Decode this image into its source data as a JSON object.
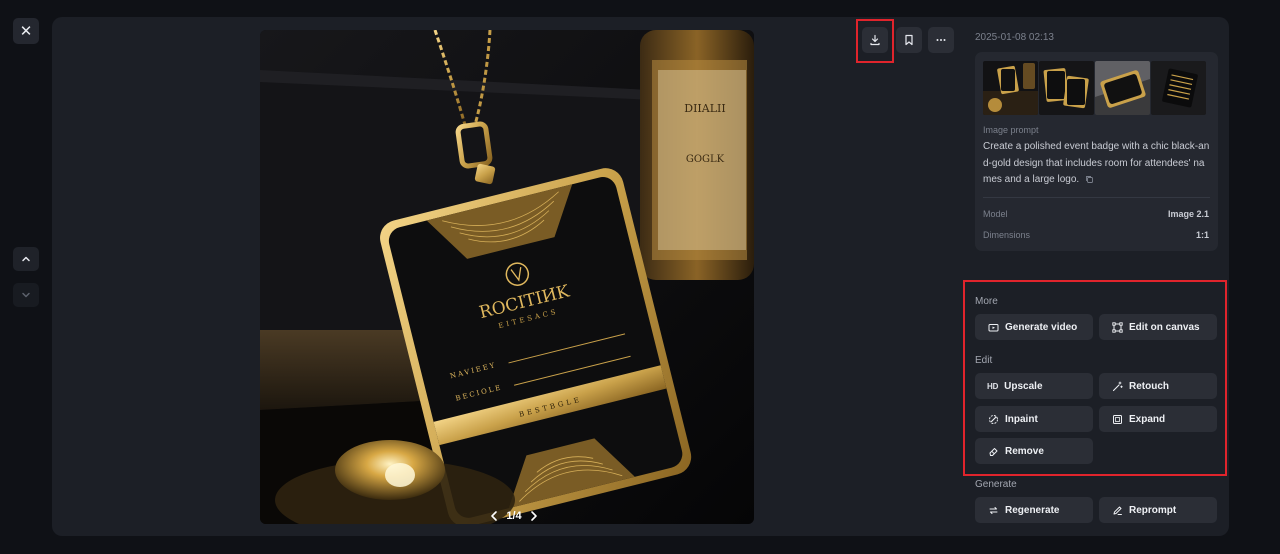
{
  "window": {
    "close_label": "✕"
  },
  "viewer": {
    "pager_text": "1/4",
    "badge": {
      "brand": "ROCITIИK",
      "subtitle": "EITESACS",
      "line1": "NAVIEEY",
      "line2": "BECIOLE",
      "strip": "BESTBGLE"
    },
    "bottle_text": {
      "line1": "DIIALII",
      "line2": "GOGLK"
    }
  },
  "toolbar": {
    "download": "download-icon",
    "bookmark": "bookmark-icon",
    "more": "more-icon"
  },
  "info": {
    "timestamp": "2025-01-08 02:13",
    "prompt_label": "Image prompt",
    "prompt_text": "Create a polished event badge with a chic black-and-gold design that includes room for attendees' names and a large logo.",
    "model_key": "Model",
    "model_value": "Image 2.1",
    "dimensions_key": "Dimensions",
    "dimensions_value": "1:1"
  },
  "sections": {
    "more_label": "More",
    "edit_label": "Edit",
    "generate_label": "Generate"
  },
  "buttons": {
    "generate_video": "Generate video",
    "edit_on_canvas": "Edit on canvas",
    "upscale": "Upscale",
    "upscale_prefix": "HD",
    "retouch": "Retouch",
    "inpaint": "Inpaint",
    "expand": "Expand",
    "remove": "Remove",
    "regenerate": "Regenerate",
    "reprompt": "Reprompt"
  },
  "colors": {
    "highlight": "#e0242c",
    "panel": "#1c1f26",
    "button": "#2b2e36",
    "gold": "#c9a14a"
  }
}
